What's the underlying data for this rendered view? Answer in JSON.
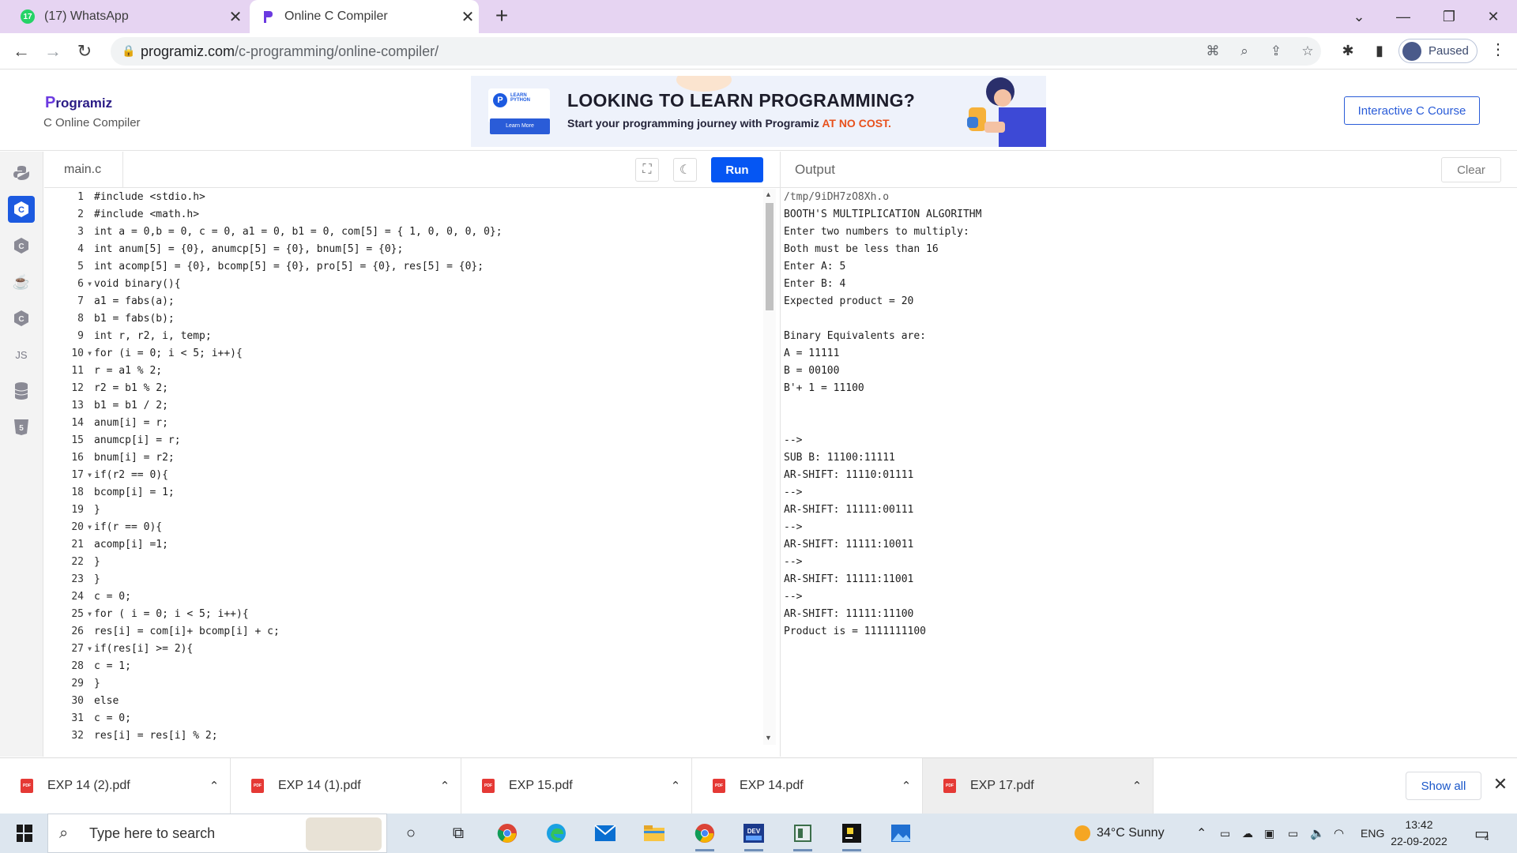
{
  "browser": {
    "tabs": [
      {
        "title": "(17) WhatsApp",
        "favicon_badge": "17"
      },
      {
        "title": "Online C Compiler"
      }
    ],
    "url_domain": "programiz.com",
    "url_path": "/c-programming/online-compiler/",
    "profile_label": "Paused"
  },
  "site": {
    "logo": "rogramiz",
    "logo_letter": "P",
    "subtitle": "C Online Compiler",
    "course_button": "Interactive C Course",
    "banner": {
      "badge_text": "LEARN PYTHON",
      "learn_button": "Learn More",
      "title": "LOOKING TO LEARN PROGRAMMING?",
      "subtitle": "Start your programming journey with Programiz",
      "accent": "AT NO COST."
    }
  },
  "rail": {
    "items": [
      "python-icon",
      "c-icon",
      "cpp-icon",
      "java-icon",
      "csharp-icon",
      "js-icon",
      "sql-icon",
      "html-icon"
    ],
    "js_label": "JS"
  },
  "editor": {
    "file_tab": "main.c",
    "run_label": "Run",
    "lines": [
      "#include <stdio.h>",
      "#include <math.h>",
      "int a = 0,b = 0, c = 0, a1 = 0, b1 = 0, com[5] = { 1, 0, 0, 0, 0};",
      "int anum[5] = {0}, anumcp[5] = {0}, bnum[5] = {0};",
      "int acomp[5] = {0}, bcomp[5] = {0}, pro[5] = {0}, res[5] = {0};",
      "void binary(){",
      "a1 = fabs(a);",
      "b1 = fabs(b);",
      "int r, r2, i, temp;",
      "for (i = 0; i < 5; i++){",
      "r = a1 % 2;",
      "r2 = b1 % 2;",
      "b1 = b1 / 2;",
      "anum[i] = r;",
      "anumcp[i] = r;",
      "bnum[i] = r2;",
      "if(r2 == 0){",
      "bcomp[i] = 1;",
      "}",
      "if(r == 0){",
      "acomp[i] =1;",
      "}",
      "}",
      "c = 0;",
      "for ( i = 0; i < 5; i++){",
      "res[i] = com[i]+ bcomp[i] + c;",
      "if(res[i] >= 2){",
      "c = 1;",
      "}",
      "else",
      "c = 0;",
      "res[i] = res[i] % 2;"
    ],
    "folded_lines": [
      6,
      10,
      17,
      20,
      25,
      27
    ]
  },
  "output": {
    "title": "Output",
    "clear_label": "Clear",
    "lines": [
      "/tmp/9iDH7zO8Xh.o",
      "BOOTH'S MULTIPLICATION ALGORITHM",
      "Enter two numbers to multiply:",
      "Both must be less than 16",
      "Enter A: 5",
      "Enter B: 4",
      "Expected product = 20",
      "",
      "Binary Equivalents are:",
      "A = 11111",
      "B = 00100",
      "B'+ 1 = 11100",
      "",
      "",
      "-->",
      "SUB B: 11100:11111",
      "AR-SHIFT: 11110:01111",
      "-->",
      "AR-SHIFT: 11111:00111",
      "-->",
      "AR-SHIFT: 11111:10011",
      "-->",
      "AR-SHIFT: 11111:11001",
      "-->",
      "AR-SHIFT: 11111:11100",
      "Product is = 1111111100"
    ]
  },
  "downloads": {
    "items": [
      "EXP 14 (2).pdf",
      "EXP 14 (1).pdf",
      "EXP 15.pdf",
      "EXP 14.pdf",
      "EXP 17.pdf"
    ],
    "pdf_badge": "PDF",
    "show_all": "Show all"
  },
  "taskbar": {
    "search_placeholder": "Type here to search",
    "weather": "34°C  Sunny",
    "language": "ENG",
    "time": "13:42",
    "date": "22-09-2022",
    "notification_count": "4"
  },
  "colors": {
    "tab_bar": "#e6d4f2",
    "run_button": "#0556f3",
    "brand": "#2b1c86",
    "accent_orange": "#e8511d"
  }
}
